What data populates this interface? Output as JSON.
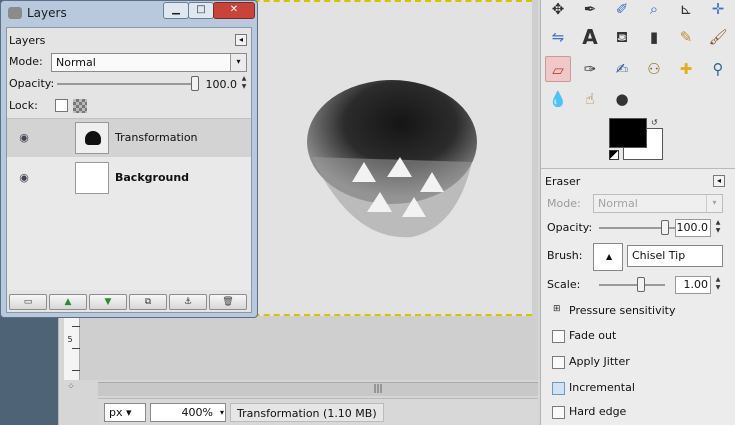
{
  "layers_dialog": {
    "window_title": "Layers",
    "panel_title": "Layers",
    "mode_label": "Mode:",
    "mode_value": "Normal",
    "opacity_label": "Opacity:",
    "opacity_value": "100.0",
    "opacity_level": 1.0,
    "lock_label": "Lock:",
    "layers": [
      {
        "name": "Transformation",
        "visible": true,
        "selected": true
      },
      {
        "name": "Background",
        "visible": true,
        "selected": false
      }
    ],
    "buttons": [
      "new-layer",
      "raise-layer",
      "lower-layer",
      "duplicate-layer",
      "anchor-layer",
      "delete-layer"
    ]
  },
  "image_window": {
    "ruler_label": "5",
    "unit": "px",
    "zoom": "400%",
    "status": "Transformation (1.10 MB)"
  },
  "toolbox": {
    "tools": [
      "align",
      "paths",
      "color-picker",
      "zoom",
      "measure",
      "move",
      "crop",
      "rotate",
      "scale",
      "shear",
      "perspective",
      "flip",
      "cage",
      "text",
      "bucket-fill",
      "blend",
      "pencil",
      "paintbrush",
      "eraser",
      "airbrush",
      "ink",
      "clone",
      "heal",
      "perspective-clone",
      "blur",
      "smudge",
      "dodge-burn"
    ],
    "active_tool": "eraser",
    "fg_color": "#000000",
    "bg_color": "#ffffff"
  },
  "tool_options": {
    "title": "Eraser",
    "mode_label": "Mode:",
    "mode_value": "Normal",
    "opacity_label": "Opacity:",
    "opacity_value": "100.0",
    "brush_label": "Brush:",
    "brush_name": "Chisel Tip",
    "scale_label": "Scale:",
    "scale_value": "1.00",
    "pressure_label": "Pressure sensitivity",
    "options": [
      {
        "label": "Fade out",
        "checked": false
      },
      {
        "label": "Apply Jitter",
        "checked": false
      },
      {
        "label": "Incremental",
        "checked": true
      },
      {
        "label": "Hard edge",
        "checked": false
      }
    ]
  }
}
